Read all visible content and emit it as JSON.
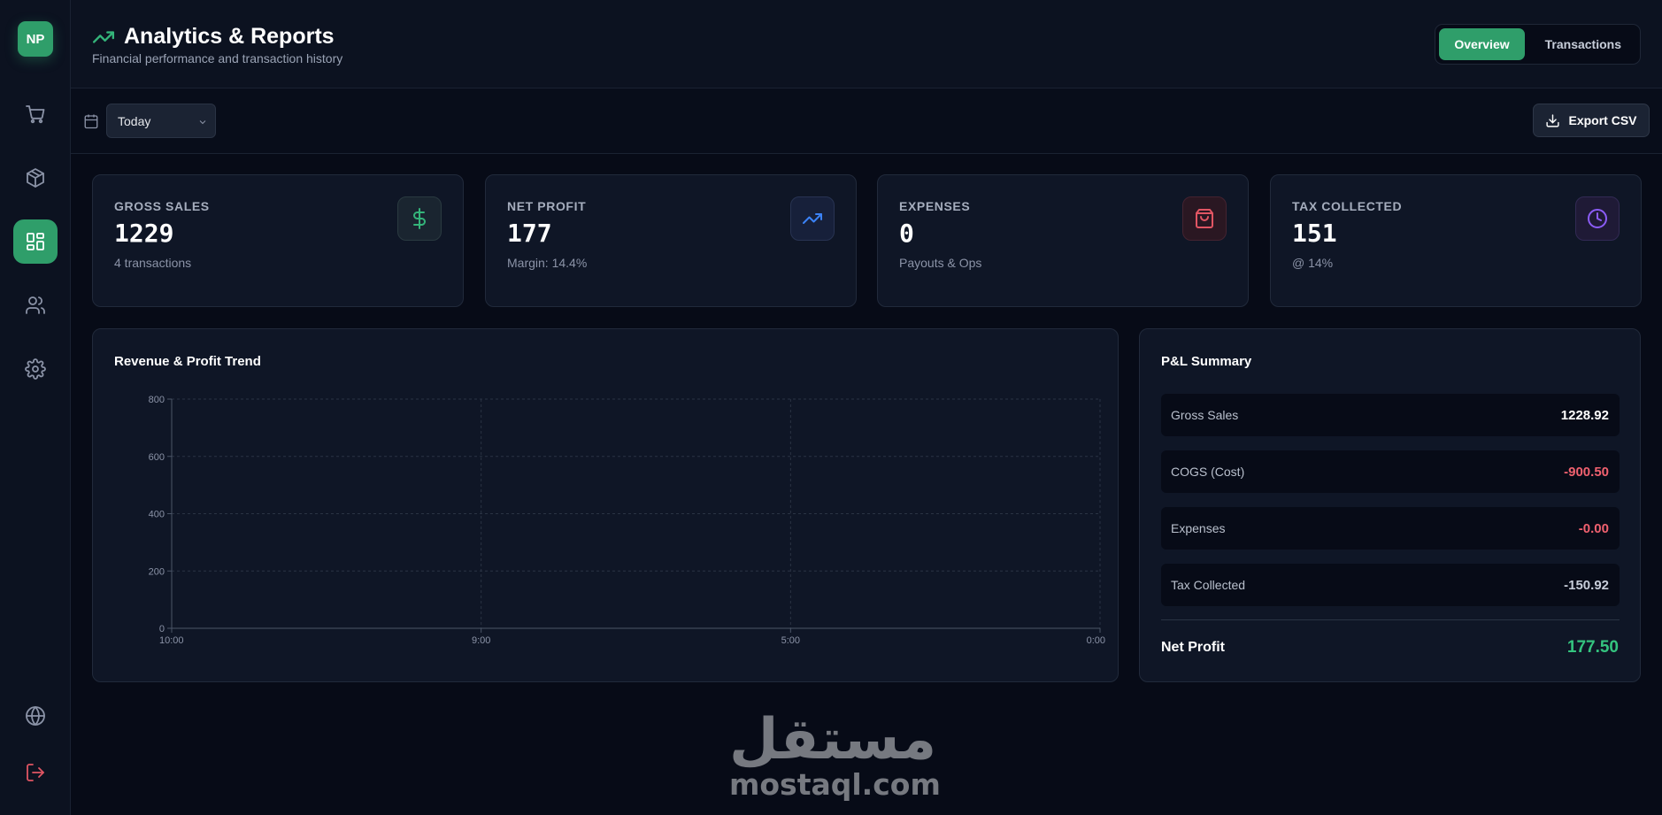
{
  "sidebar": {
    "logo": "NP",
    "items": [
      {
        "name": "sales",
        "icon": "cart-icon",
        "active": false
      },
      {
        "name": "inventory",
        "icon": "box-icon",
        "active": false
      },
      {
        "name": "analytics",
        "icon": "dashboard-icon",
        "active": true
      },
      {
        "name": "customers",
        "icon": "users-icon",
        "active": false
      },
      {
        "name": "settings",
        "icon": "gear-icon",
        "active": false
      }
    ],
    "bottom": [
      {
        "name": "language",
        "icon": "globe-icon"
      },
      {
        "name": "logout",
        "icon": "logout-icon"
      }
    ]
  },
  "header": {
    "title": "Analytics & Reports",
    "subtitle": "Financial performance and transaction history",
    "tabs": [
      {
        "label": "Overview",
        "active": true
      },
      {
        "label": "Transactions",
        "active": false
      }
    ]
  },
  "toolbar": {
    "date_range": "Today",
    "export_label": "Export CSV"
  },
  "stats": [
    {
      "label": "GROSS SALES",
      "value": "1229",
      "sub": "4 transactions",
      "icon": "dollar-icon",
      "color": "#34b47a"
    },
    {
      "label": "NET PROFIT",
      "value": "177",
      "sub": "Margin: 14.4%",
      "icon": "trending-up-icon",
      "color": "#3b82f6"
    },
    {
      "label": "EXPENSES",
      "value": "0",
      "sub": "Payouts & Ops",
      "icon": "shopping-bag-icon",
      "color": "#e05563"
    },
    {
      "label": "TAX COLLECTED",
      "value": "151",
      "sub": "@ 14%",
      "icon": "clock-icon",
      "color": "#8b5cf6"
    }
  ],
  "chart": {
    "title": "Revenue & Profit Trend"
  },
  "chart_data": {
    "type": "line",
    "title": "Revenue & Profit Trend",
    "x": [
      "10:00",
      "9:00",
      "5:00",
      "0:00"
    ],
    "y_ticks": [
      0,
      200,
      400,
      600,
      800
    ],
    "ylim": [
      0,
      800
    ],
    "series": [],
    "grid": true
  },
  "pl": {
    "title": "P&L Summary",
    "rows": [
      {
        "label": "Gross Sales",
        "value": "1228.92",
        "color": "#ffffff"
      },
      {
        "label": "COGS (Cost)",
        "value": "-900.50",
        "color": "#f0616f"
      },
      {
        "label": "Expenses",
        "value": "-0.00",
        "color": "#f0616f"
      },
      {
        "label": "Tax Collected",
        "value": "-150.92",
        "color": "#c7cdd9"
      }
    ],
    "net_label": "Net Profit",
    "net_value": "177.50"
  },
  "watermark": {
    "arabic": "مستقل",
    "latin": "mostaql.com"
  }
}
